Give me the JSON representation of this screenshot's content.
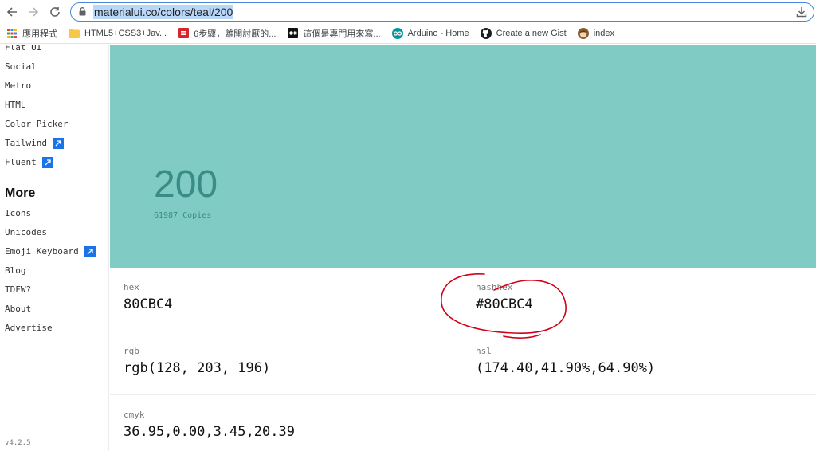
{
  "browser": {
    "url": "materialui.co/colors/teal/200",
    "bookmarks": [
      {
        "label": "應用程式",
        "icon": "apps-grid-icon"
      },
      {
        "label": "HTML5+CSS3+Jav...",
        "icon": "folder-icon"
      },
      {
        "label": "6步驟，離開討厭的...",
        "icon": "site-favicon-icon"
      },
      {
        "label": "這個是專門用來寫...",
        "icon": "medium-icon"
      },
      {
        "label": "Arduino - Home",
        "icon": "arduino-icon"
      },
      {
        "label": "Create a new Gist",
        "icon": "github-icon"
      },
      {
        "label": "index",
        "icon": "avatar-icon"
      }
    ]
  },
  "sidebar": {
    "items": [
      {
        "label": "Flat UI",
        "external": false
      },
      {
        "label": "Social",
        "external": false
      },
      {
        "label": "Metro",
        "external": false
      },
      {
        "label": "HTML",
        "external": false
      },
      {
        "label": "Color Picker",
        "external": false
      },
      {
        "label": "Tailwind",
        "external": true
      },
      {
        "label": "Fluent",
        "external": true
      }
    ],
    "more_heading": "More",
    "more_items": [
      {
        "label": "Icons",
        "external": false
      },
      {
        "label": "Unicodes",
        "external": false
      },
      {
        "label": "Emoji Keyboard",
        "external": true
      },
      {
        "label": "Blog",
        "external": false
      },
      {
        "label": "TDFW?",
        "external": false
      },
      {
        "label": "About",
        "external": false
      },
      {
        "label": "Advertise",
        "external": false
      }
    ],
    "version": "v4.2.5"
  },
  "swatch": {
    "shade": "200",
    "copies": "61987 Copies",
    "color": "#80CBC4",
    "text_color": "#3b8c84"
  },
  "values": [
    {
      "label": "hex",
      "value": "80CBC4"
    },
    {
      "label": "hashhex",
      "value": "#80CBC4"
    },
    {
      "label": "rgb",
      "value": "rgb(128, 203, 196)"
    },
    {
      "label": "hsl",
      "value": "(174.40,41.90%,64.90%)"
    },
    {
      "label": "cmyk",
      "value": "36.95,0.00,3.45,20.39"
    }
  ],
  "annotation_color": "#d0021b"
}
